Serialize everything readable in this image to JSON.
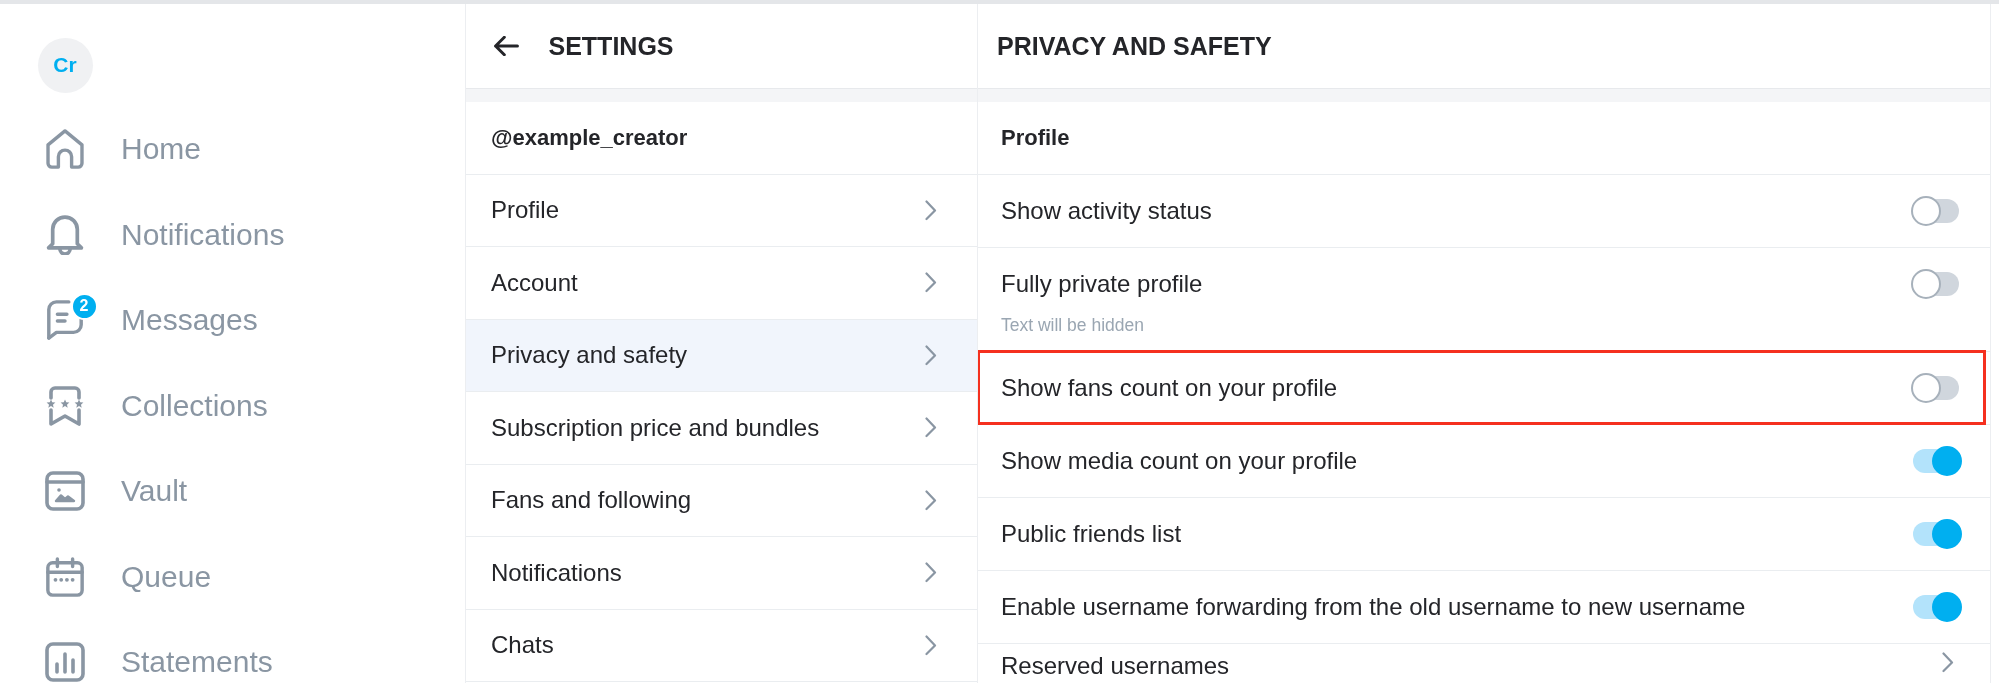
{
  "sidebar": {
    "avatar": {
      "initials": "Cr"
    },
    "items": [
      {
        "label": "Home",
        "selected": false
      },
      {
        "label": "Notifications",
        "selected": false
      },
      {
        "label": "Messages",
        "badge": "2",
        "selected": false
      },
      {
        "label": "Collections",
        "selected": false
      },
      {
        "label": "Vault",
        "selected": false
      },
      {
        "label": "Queue",
        "selected": false
      },
      {
        "label": "Statements",
        "selected": false
      }
    ]
  },
  "settings": {
    "title": "SETTINGS",
    "username": "@example_creator",
    "items": [
      {
        "label": "Profile",
        "selected": false
      },
      {
        "label": "Account",
        "selected": false
      },
      {
        "label": "Privacy and safety",
        "selected": true
      },
      {
        "label": "Subscription price and bundles",
        "selected": false
      },
      {
        "label": "Fans and following",
        "selected": false
      },
      {
        "label": "Notifications",
        "selected": false
      },
      {
        "label": "Chats",
        "selected": false
      }
    ]
  },
  "privacy": {
    "title": "PRIVACY AND SAFETY",
    "section": "Profile",
    "items": [
      {
        "kind": "toggle",
        "label": "Show activity status",
        "on": false,
        "highlighted": false
      },
      {
        "kind": "toggle",
        "label": "Fully private profile",
        "hint": "Text will be hidden",
        "on": false,
        "highlighted": false
      },
      {
        "kind": "toggle",
        "label": "Show fans count on your profile",
        "on": false,
        "highlighted": true
      },
      {
        "kind": "toggle",
        "label": "Show media count on your profile",
        "on": true,
        "highlighted": false
      },
      {
        "kind": "toggle",
        "label": "Public friends list",
        "on": true,
        "highlighted": false
      },
      {
        "kind": "toggle",
        "label": "Enable username forwarding from the old username to new username",
        "on": true,
        "highlighted": false
      },
      {
        "kind": "link",
        "label": "Reserved usernames",
        "highlighted": false
      }
    ]
  }
}
